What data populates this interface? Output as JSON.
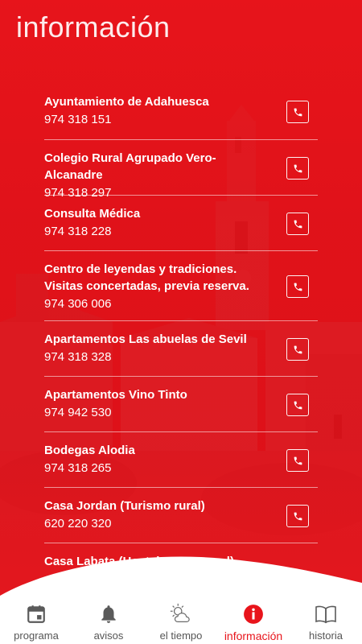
{
  "header": {
    "title": "información"
  },
  "contacts": [
    {
      "name": "Ayuntamiento de Adahuesca",
      "phone": "974 318 151"
    },
    {
      "name": "Colegio Rural Agrupado Vero-Alcanadre",
      "phone": "974 318 297"
    },
    {
      "name": "Consulta Médica",
      "phone": "974 318 228"
    },
    {
      "name": "Centro de leyendas y tradiciones. Visitas concertadas, previa reserva.",
      "phone": "974 306 006"
    },
    {
      "name": "Apartamentos Las abuelas de Sevil",
      "phone": "974 318 328"
    },
    {
      "name": "Apartamentos Vino Tinto",
      "phone": "974 942 530"
    },
    {
      "name": "Bodegas Alodia",
      "phone": "974 318 265"
    },
    {
      "name": "Casa Jordan (Turismo rural)",
      "phone": "620 220 320"
    },
    {
      "name": "Casa Labata (Hostal y casa rural)",
      "phone": ""
    }
  ],
  "call_icon": "phone-icon",
  "tabs": [
    {
      "label": "programa",
      "icon": "calendar-icon",
      "active": false
    },
    {
      "label": "avisos",
      "icon": "bell-icon",
      "active": false
    },
    {
      "label": "el tiempo",
      "icon": "weather-icon",
      "active": false
    },
    {
      "label": "información",
      "icon": "info-icon",
      "active": true
    },
    {
      "label": "historia",
      "icon": "book-icon",
      "active": false
    }
  ],
  "colors": {
    "accent": "#e8141b",
    "text_on_accent": "#ffffff",
    "tab_text": "#555555"
  }
}
